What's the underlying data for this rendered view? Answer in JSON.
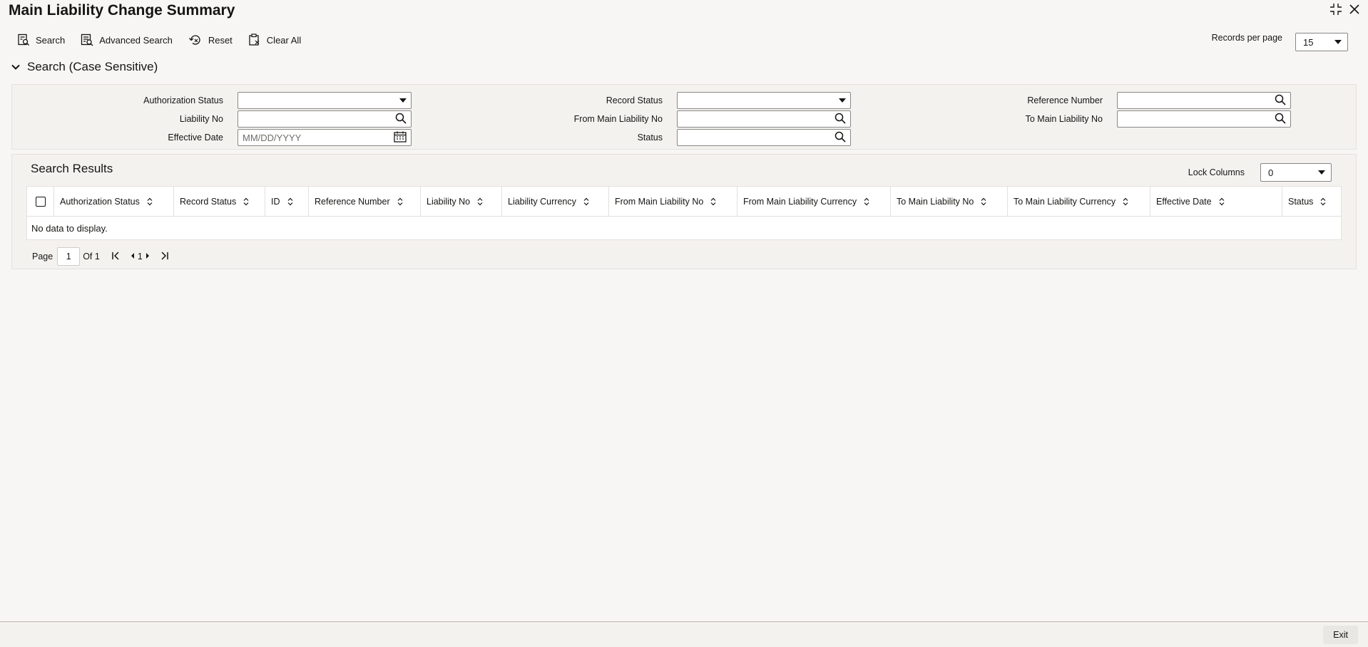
{
  "window": {
    "title": "Main Liability Change Summary",
    "icons": [
      "collapse-icon",
      "close-icon"
    ]
  },
  "toolbar": {
    "search_label": "Search",
    "advanced_search_label": "Advanced Search",
    "reset_label": "Reset",
    "clear_all_label": "Clear All"
  },
  "records_per_page": {
    "label": "Records per page",
    "value": "15"
  },
  "criteria": {
    "heading": "Search (Case Sensitive)",
    "authorization_status_label": "Authorization Status",
    "record_status_label": "Record Status",
    "reference_number_label": "Reference Number",
    "liability_no_label": "Liability No",
    "from_main_liability_no_label": "From Main Liability No",
    "to_main_liability_no_label": "To Main Liability No",
    "effective_date_label": "Effective Date",
    "effective_date_placeholder": "MM/DD/YYYY",
    "status_label": "Status"
  },
  "results": {
    "heading": "Search Results",
    "lock_columns_label": "Lock Columns",
    "lock_columns_value": "0",
    "columns": [
      "Authorization Status",
      "Record Status",
      "ID",
      "Reference Number",
      "Liability No",
      "Liability Currency",
      "From Main Liability No",
      "From Main Liability Currency",
      "To Main Liability No",
      "To Main Liability Currency",
      "Effective Date",
      "Status"
    ],
    "empty_message": "No data to display."
  },
  "pager": {
    "page_label": "Page",
    "page_value": "1",
    "of_label": "Of 1",
    "current_page": "1"
  },
  "footer": {
    "exit_label": "Exit"
  },
  "colors": {
    "background": "#f7f6f4",
    "panel": "#f4f2ef",
    "text": "#161513",
    "border": "#8a8886"
  }
}
